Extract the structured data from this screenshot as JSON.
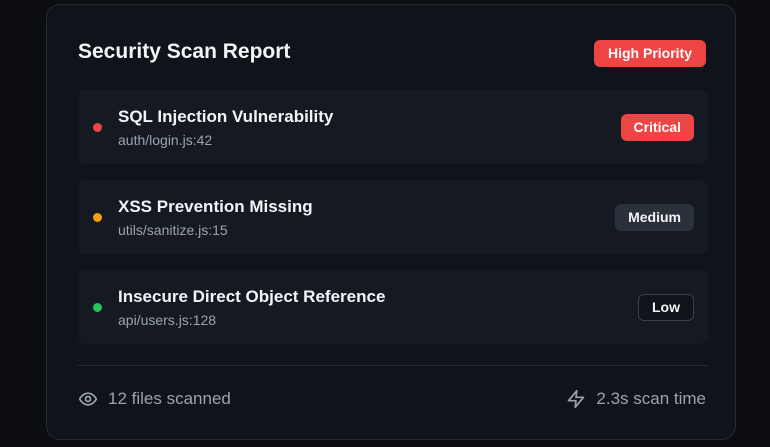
{
  "report": {
    "title": "Security Scan Report",
    "priority_label": "High Priority"
  },
  "issues": [
    {
      "name": "SQL Injection Vulnerability",
      "location": "auth/login.js:42",
      "severity": "Critical",
      "dot_color": "#ef4444"
    },
    {
      "name": "XSS Prevention Missing",
      "location": "utils/sanitize.js:15",
      "severity": "Medium",
      "dot_color": "#f59e0b"
    },
    {
      "name": "Insecure Direct Object Reference",
      "location": "api/users.js:128",
      "severity": "Low",
      "dot_color": "#22c55e"
    }
  ],
  "footer": {
    "files_scanned": "12 files scanned",
    "scan_time": "2.3s scan time",
    "files_icon": "eye-icon",
    "time_icon": "lightning-icon"
  },
  "colors": {
    "critical": "#ef4444",
    "background": "#0f131a"
  }
}
